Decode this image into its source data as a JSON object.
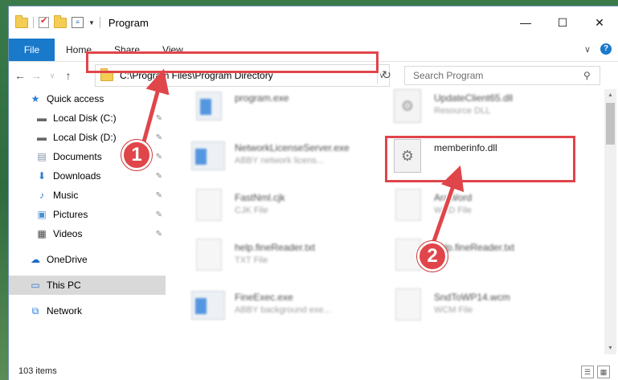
{
  "window": {
    "title": "Program",
    "controls": {
      "minimize": "—",
      "maximize": "☐",
      "close": "✕"
    }
  },
  "ribbon": {
    "tabs": [
      "File",
      "Home",
      "Share",
      "View"
    ]
  },
  "address": {
    "path": "C:\\Program Files\\Program Directory"
  },
  "search": {
    "placeholder": "Search Program"
  },
  "navpane": {
    "items": [
      {
        "label": "Quick access",
        "icon": "star-icon"
      },
      {
        "label": "Local Disk (C:)",
        "icon": "drive-icon",
        "pinned": true
      },
      {
        "label": "Local Disk (D:)",
        "icon": "drive-icon",
        "pinned": true
      },
      {
        "label": "Documents",
        "icon": "documents-icon",
        "pinned": true
      },
      {
        "label": "Downloads",
        "icon": "download-icon",
        "pinned": true
      },
      {
        "label": "Music",
        "icon": "music-icon",
        "pinned": true
      },
      {
        "label": "Pictures",
        "icon": "pictures-icon",
        "pinned": true
      },
      {
        "label": "Videos",
        "icon": "video-icon",
        "pinned": true
      },
      {
        "label": "OneDrive",
        "icon": "cloud-icon"
      },
      {
        "label": "This PC",
        "icon": "computer-icon",
        "selected": true
      },
      {
        "label": "Network",
        "icon": "network-icon"
      }
    ]
  },
  "files": [
    {
      "name": "program.exe",
      "type": ""
    },
    {
      "name": "UpdateClient65.dll",
      "type": "Resource DLL"
    },
    {
      "name": "NetworkLicenseServer.exe",
      "type": "ABBY network licens..."
    },
    {
      "name": "memberinfo.dll",
      "type": ""
    },
    {
      "name": "FastNml.cjk",
      "type": "CJK File"
    },
    {
      "name": "AraWord",
      "type": "WRD File"
    },
    {
      "name": "help.fineReader.txt",
      "type": "TXT File"
    },
    {
      "name": "help.fineReader.txt",
      "type": "File"
    },
    {
      "name": "FineExec.exe",
      "type": "ABBY background exe..."
    },
    {
      "name": "SndToWP14.wcm",
      "type": "WCM File"
    }
  ],
  "status": {
    "count": "103 items"
  },
  "callouts": {
    "one": "1",
    "two": "2"
  },
  "colors": {
    "accent": "#1979ca",
    "highlight": "#e0454a"
  }
}
